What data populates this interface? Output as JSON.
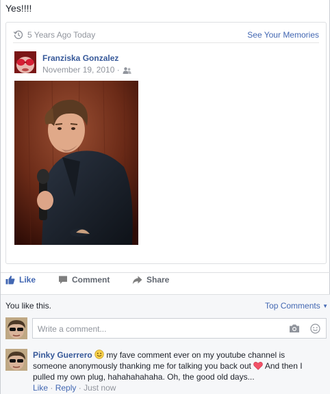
{
  "post": {
    "text": "Yes!!!!"
  },
  "memory": {
    "title": "5 Years Ago Today",
    "see_memories": "See Your Memories",
    "shared_post": {
      "author": "Franziska Gonzalez",
      "date": "November 19, 2010 ·"
    }
  },
  "actions": {
    "like": "Like",
    "comment": "Comment",
    "share": "Share"
  },
  "likes": {
    "summary": "You like this.",
    "sort": "Top Comments"
  },
  "composer": {
    "placeholder": "Write a comment..."
  },
  "comments": [
    {
      "author": "Pinky Guerrero",
      "text_before_heart": " my fave comment ever on my youtube channel is someone anonymously thanking me for talking you back out ",
      "text_after_heart": " And then I pulled my own plug, hahahahahaha. Oh, the good old days...",
      "like": "Like",
      "reply": "Reply",
      "time": "Just now"
    }
  ],
  "colors": {
    "link": "#4267b2",
    "name": "#365899",
    "muted": "#90949c",
    "heart": "#f25268"
  }
}
